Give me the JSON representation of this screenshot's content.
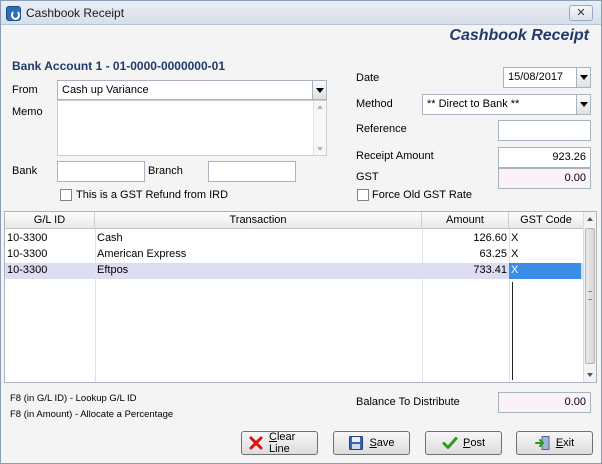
{
  "window": {
    "title": "Cashbook Receipt",
    "close_label": "✕"
  },
  "header": {
    "form_title": "Cashbook Receipt",
    "account_title": "Bank Account 1 - 01-0000-0000000-01"
  },
  "left": {
    "from_label": "From",
    "from_value": "Cash up Variance",
    "memo_label": "Memo",
    "memo_value": "",
    "bank_label": "Bank",
    "bank_value": "",
    "branch_label": "Branch",
    "branch_value": "",
    "gst_refund_label": "This is a GST Refund from IRD"
  },
  "right": {
    "date_label": "Date",
    "date_value": "15/08/2017",
    "method_label": "Method",
    "method_value": "** Direct to Bank **",
    "reference_label": "Reference",
    "reference_value": "",
    "receipt_amount_label": "Receipt Amount",
    "receipt_amount_value": "923.26",
    "gst_label": "GST",
    "gst_value": "0.00",
    "force_old_gst_label": "Force Old GST Rate"
  },
  "grid": {
    "columns": [
      "G/L ID",
      "Transaction",
      "Amount",
      "GST Code"
    ],
    "rows": [
      {
        "gl_id": "10-3300",
        "transaction": "Cash",
        "amount": "126.60",
        "gst_code": "X"
      },
      {
        "gl_id": "10-3300",
        "transaction": "American Express",
        "amount": "63.25",
        "gst_code": "X"
      },
      {
        "gl_id": "10-3300",
        "transaction": "Eftpos",
        "amount": "733.41",
        "gst_code": "X"
      }
    ]
  },
  "footer": {
    "hint1": "F8 (in G/L ID) - Lookup G/L ID",
    "hint2": "F8 (in Amount) - Allocate a Percentage",
    "balance_label": "Balance To Distribute",
    "balance_value": "0.00"
  },
  "buttons": {
    "clear_line_first": "C",
    "clear_line_rest": "lear Line",
    "save_first": "S",
    "save_rest": "ave",
    "post_first": "P",
    "post_rest": "ost",
    "exit_first": "E",
    "exit_rest": "xit"
  },
  "icons": {
    "app": "app-power-icon",
    "clear_line": "red-x-icon",
    "save": "floppy-disk-icon",
    "post": "green-check-icon",
    "exit": "exit-door-icon"
  }
}
